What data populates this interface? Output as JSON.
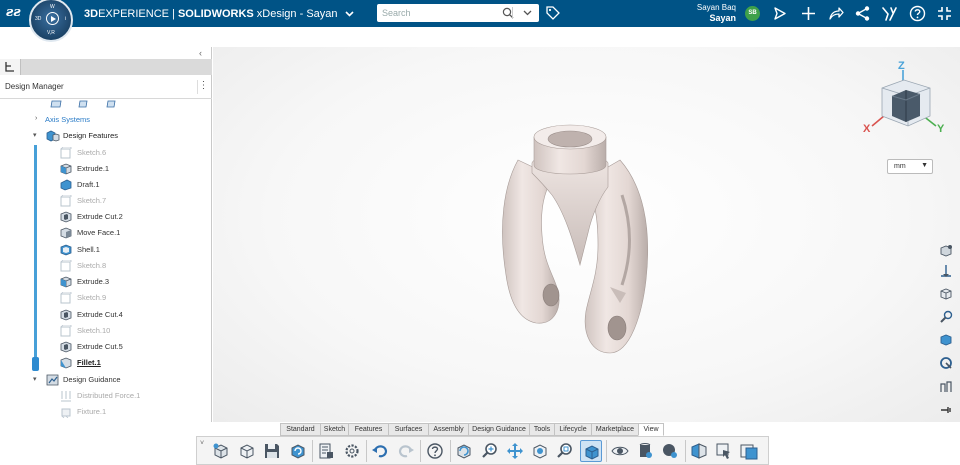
{
  "topbar": {
    "compass": {
      "top_label": "W",
      "left_label": "3D",
      "right_label": "i",
      "bottom_label": "V,R"
    },
    "brand_3d": "3D",
    "brand_experience": "EXPERIENCE",
    "brand_sep": " | ",
    "brand_solidworks": "SOLIDWORKS",
    "app_suffix": " xDesign - Sayan",
    "search_placeholder": "Search",
    "user_line1": "Sayan Baq",
    "user_line2": "Sayan",
    "avatar_initials": "SB"
  },
  "panel": {
    "title": "Design Manager",
    "kebab": "⋮",
    "collapse": "‹",
    "tree": [
      {
        "label": "Axis Systems",
        "style": "link",
        "depth": 0,
        "caret": "›",
        "icon": "none"
      },
      {
        "label": "Design Features",
        "style": "bold",
        "depth": 0,
        "caret": "▾",
        "icon": "design-features-icon"
      },
      {
        "label": "Sketch.6",
        "style": "dim",
        "depth": 1,
        "icon": "sketch-icon"
      },
      {
        "label": "Extrude.1",
        "style": "normal",
        "depth": 1,
        "icon": "extrude-icon"
      },
      {
        "label": "Draft.1",
        "style": "normal",
        "depth": 1,
        "icon": "draft-icon"
      },
      {
        "label": "Sketch.7",
        "style": "dim",
        "depth": 1,
        "icon": "sketch-icon"
      },
      {
        "label": "Extrude Cut.2",
        "style": "normal",
        "depth": 1,
        "icon": "extrude-cut-icon"
      },
      {
        "label": "Move Face.1",
        "style": "normal",
        "depth": 1,
        "icon": "move-face-icon"
      },
      {
        "label": "Shell.1",
        "style": "normal",
        "depth": 1,
        "icon": "shell-icon"
      },
      {
        "label": "Sketch.8",
        "style": "dim",
        "depth": 1,
        "icon": "sketch-icon"
      },
      {
        "label": "Extrude.3",
        "style": "normal",
        "depth": 1,
        "icon": "extrude-icon"
      },
      {
        "label": "Sketch.9",
        "style": "dim",
        "depth": 1,
        "icon": "sketch-icon"
      },
      {
        "label": "Extrude Cut.4",
        "style": "normal",
        "depth": 1,
        "icon": "extrude-cut-icon"
      },
      {
        "label": "Sketch.10",
        "style": "dim",
        "depth": 1,
        "icon": "sketch-icon"
      },
      {
        "label": "Extrude Cut.5",
        "style": "normal",
        "depth": 1,
        "icon": "extrude-cut-icon"
      },
      {
        "label": "Fillet.1",
        "style": "under",
        "depth": 1,
        "icon": "fillet-icon"
      },
      {
        "label": "Design Guidance",
        "style": "normal",
        "depth": 0,
        "caret": "▾",
        "icon": "design-guidance-icon"
      },
      {
        "label": "Distributed Force.1",
        "style": "dim",
        "depth": 1,
        "icon": "force-icon"
      },
      {
        "label": "Fixture.1",
        "style": "dim",
        "depth": 1,
        "icon": "fixture-icon"
      }
    ]
  },
  "viewport": {
    "unit": "mm",
    "unit_arrow": "▼",
    "axis_x": "X",
    "axis_y": "Y",
    "axis_z": "Z",
    "colors": {
      "x": "#d9534f",
      "y": "#4caf50",
      "z": "#4aa3d9",
      "part": "#e6dad6"
    }
  },
  "command_tabs": [
    "Standard",
    "Sketch",
    "Features",
    "Surfaces",
    "Assembly",
    "Design Guidance",
    "Tools",
    "Lifecycle",
    "Marketplace",
    "View"
  ],
  "active_tab": "View",
  "command_icons": [
    "new-design-icon",
    "open-icon",
    "save-icon",
    "sync-icon",
    "properties-icon",
    "settings-icon",
    "undo-icon",
    "redo-icon",
    "help-icon",
    "rotate-icon",
    "zoom-icon",
    "pan-icon",
    "orbit-icon",
    "zoom-fit-icon",
    "view-cube-icon",
    "hide-show-icon",
    "appearance-icon",
    "scene-icon",
    "section-icon",
    "display-style-icon",
    "capture-icon"
  ],
  "active_command": "view-cube-icon"
}
